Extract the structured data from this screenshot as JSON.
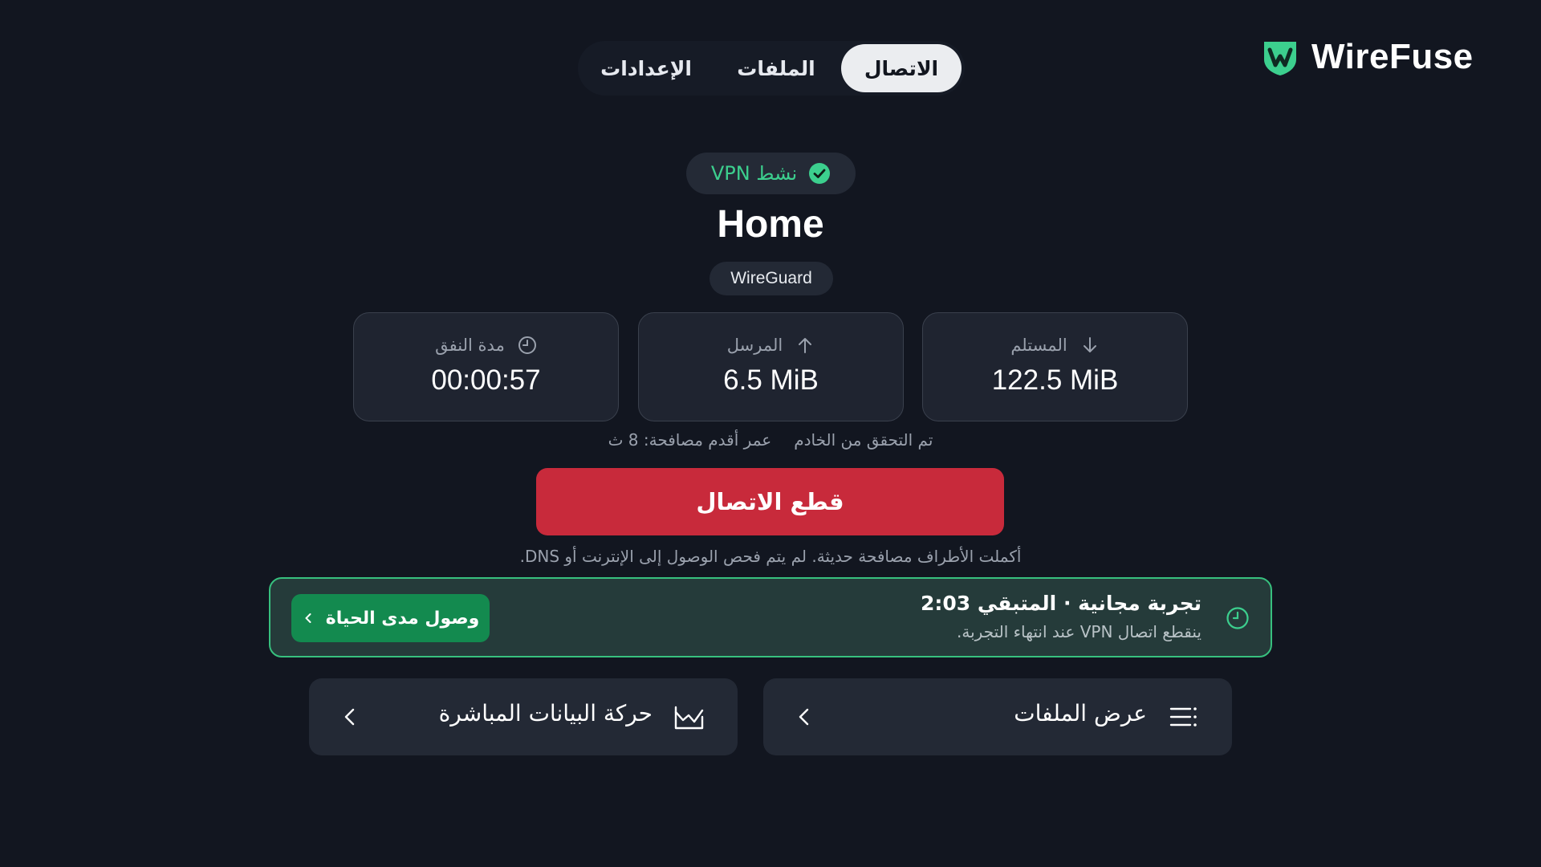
{
  "app": {
    "name": "WireFuse",
    "accent": "#3ccf8e",
    "danger": "#c82a3b"
  },
  "tabs": [
    {
      "label": "الاتصال",
      "active": true
    },
    {
      "label": "الملفات",
      "active": false
    },
    {
      "label": "الإعدادات",
      "active": false
    }
  ],
  "status": {
    "label": "نشط VPN",
    "icon": "check-circle-icon"
  },
  "profile": {
    "name": "Home",
    "protocol": "WireGuard"
  },
  "stats": {
    "received": {
      "label": "المستلم",
      "value": "122.5 MiB",
      "icon": "arrow-down-icon"
    },
    "sent": {
      "label": "المرسل",
      "value": "6.5 MiB",
      "icon": "arrow-up-icon"
    },
    "duration": {
      "label": "مدة النفق",
      "value": "00:00:57",
      "icon": "clock-icon"
    }
  },
  "handshake": {
    "verified": "تم التحقق من الخادم",
    "age": "عمر أقدم مصافحة: 8 ث"
  },
  "actions": {
    "disconnect": "قطع الاتصال"
  },
  "note": "أكملت الأطراف مصافحة حديثة. لم يتم فحص الوصول إلى الإنترنت أو DNS.",
  "trial": {
    "title": "تجربة مجانية · المتبقي 2:03",
    "subtitle": "ينقطع اتصال VPN عند انتهاء التجربة.",
    "button": "وصول مدى الحياة"
  },
  "nav": {
    "files": "عرض الملفات",
    "traffic": "حركة البيانات المباشرة"
  }
}
